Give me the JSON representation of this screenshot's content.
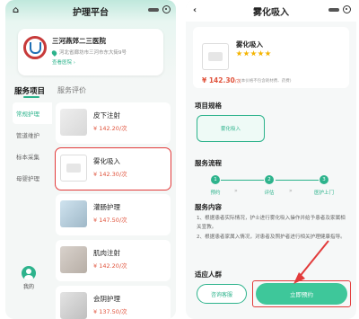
{
  "left": {
    "header": {
      "back_icon": "home-icon",
      "title": "护理平台"
    },
    "hospital": {
      "name": "三河燕郊二三医院",
      "address": "河北省廊坊市三河市东大街9号",
      "link": "查看医院 ›"
    },
    "tabs": [
      {
        "label": "服务项目",
        "active": true
      },
      {
        "label": "服务评价",
        "active": false
      }
    ],
    "categories": [
      {
        "label": "常规护理",
        "active": true
      },
      {
        "label": "管道维护",
        "active": false
      },
      {
        "label": "标本采集",
        "active": false
      },
      {
        "label": "母婴护理",
        "active": false
      }
    ],
    "services": [
      {
        "name": "皮下注射",
        "price": "¥ 142.20/次",
        "selected": false
      },
      {
        "name": "雾化吸入",
        "price": "¥ 142.30/次",
        "selected": true
      },
      {
        "name": "灌肠护理",
        "price": "¥ 147.50/次",
        "selected": false
      },
      {
        "name": "肌肉注射",
        "price": "¥ 142.20/次",
        "selected": false
      },
      {
        "name": "会阴护理",
        "price": "¥ 137.50/次",
        "selected": false
      }
    ],
    "mine_label": "我的"
  },
  "right": {
    "header": {
      "back_icon": "chevron-left-icon",
      "title": "雾化吸入"
    },
    "product": {
      "name": "雾化吸入",
      "rating": 5,
      "price": "¥ 142.30",
      "unit": "/次",
      "note": "(本价格不包含耗材费、药费)"
    },
    "spec_title": "项目规格",
    "spec_option": "雾化吸入",
    "flow_title": "服务流程",
    "steps": [
      {
        "n": "1",
        "label": "预约"
      },
      {
        "n": "2",
        "label": "评估"
      },
      {
        "n": "3",
        "label": "医护上门"
      }
    ],
    "content_title": "服务内容",
    "content": [
      "1、根据患者实际情况，护士进行雾化吸入操作并给予患者及家属相关宣教。",
      "2、根据患者家属入情况，对患者及照护者进行相关护理健康指导。"
    ],
    "crowd_title": "适应人群",
    "consult_label": "咨询客服",
    "book_label": "立即预约"
  },
  "colors": {
    "accent": "#2db38c",
    "price": "#e0533c",
    "highlight": "#e23b3b"
  }
}
